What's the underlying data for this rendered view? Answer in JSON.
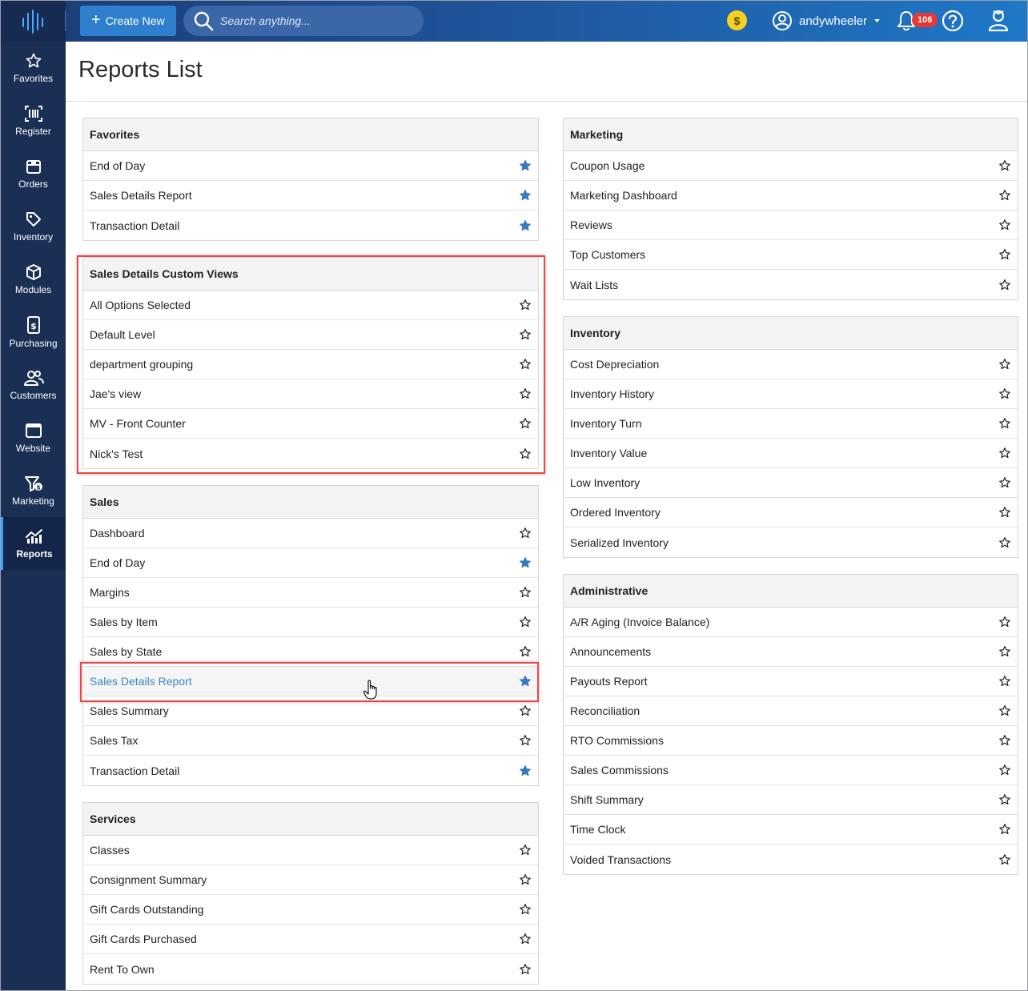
{
  "topbar": {
    "create_label": "Create New",
    "search_placeholder": "Search anything...",
    "coin_symbol": "$",
    "username": "andywheeler",
    "notification_count": "106"
  },
  "sidebar": {
    "items": [
      {
        "label": "Favorites",
        "icon": "star-icon"
      },
      {
        "label": "Register",
        "icon": "barcode-icon"
      },
      {
        "label": "Orders",
        "icon": "box-icon"
      },
      {
        "label": "Inventory",
        "icon": "tag-icon"
      },
      {
        "label": "Modules",
        "icon": "cube-icon"
      },
      {
        "label": "Purchasing",
        "icon": "invoice-icon"
      },
      {
        "label": "Customers",
        "icon": "users-icon"
      },
      {
        "label": "Website",
        "icon": "browser-icon"
      },
      {
        "label": "Marketing",
        "icon": "funnel-icon"
      },
      {
        "label": "Reports",
        "icon": "chart-icon",
        "active": true
      }
    ]
  },
  "page": {
    "title": "Reports List"
  },
  "sections": {
    "favorites": {
      "title": "Favorites",
      "items": [
        {
          "label": "End of Day",
          "starred": true
        },
        {
          "label": "Sales Details Report",
          "starred": true
        },
        {
          "label": "Transaction Detail",
          "starred": true
        }
      ]
    },
    "custom_views": {
      "title": "Sales Details Custom Views",
      "items": [
        {
          "label": "All Options Selected",
          "starred": false
        },
        {
          "label": "Default Level",
          "starred": false
        },
        {
          "label": "department grouping",
          "starred": false
        },
        {
          "label": "Jae's view",
          "starred": false
        },
        {
          "label": "MV - Front Counter",
          "starred": false
        },
        {
          "label": "Nick's Test",
          "starred": false
        }
      ]
    },
    "sales": {
      "title": "Sales",
      "items": [
        {
          "label": "Dashboard",
          "starred": false
        },
        {
          "label": "End of Day",
          "starred": true
        },
        {
          "label": "Margins",
          "starred": false
        },
        {
          "label": "Sales by Item",
          "starred": false
        },
        {
          "label": "Sales by State",
          "starred": false
        },
        {
          "label": "Sales Details Report",
          "starred": true,
          "hover": true
        },
        {
          "label": "Sales Summary",
          "starred": false
        },
        {
          "label": "Sales Tax",
          "starred": false
        },
        {
          "label": "Transaction Detail",
          "starred": true
        }
      ]
    },
    "services": {
      "title": "Services",
      "items": [
        {
          "label": "Classes",
          "starred": false
        },
        {
          "label": "Consignment Summary",
          "starred": false
        },
        {
          "label": "Gift Cards Outstanding",
          "starred": false
        },
        {
          "label": "Gift Cards Purchased",
          "starred": false
        },
        {
          "label": "Rent To Own",
          "starred": false
        }
      ]
    },
    "marketing": {
      "title": "Marketing",
      "items": [
        {
          "label": "Coupon Usage",
          "starred": false
        },
        {
          "label": "Marketing Dashboard",
          "starred": false
        },
        {
          "label": "Reviews",
          "starred": false
        },
        {
          "label": "Top Customers",
          "starred": false
        },
        {
          "label": "Wait Lists",
          "starred": false
        }
      ]
    },
    "inventory": {
      "title": "Inventory",
      "items": [
        {
          "label": "Cost Depreciation",
          "starred": false
        },
        {
          "label": "Inventory History",
          "starred": false
        },
        {
          "label": "Inventory Turn",
          "starred": false
        },
        {
          "label": "Inventory Value",
          "starred": false
        },
        {
          "label": "Low Inventory",
          "starred": false
        },
        {
          "label": "Ordered Inventory",
          "starred": false
        },
        {
          "label": "Serialized Inventory",
          "starred": false
        }
      ]
    },
    "administrative": {
      "title": "Administrative",
      "items": [
        {
          "label": "A/R Aging (Invoice Balance)",
          "starred": false
        },
        {
          "label": "Announcements",
          "starred": false
        },
        {
          "label": "Payouts Report",
          "starred": false
        },
        {
          "label": "Reconciliation",
          "starred": false
        },
        {
          "label": "RTO Commissions",
          "starred": false
        },
        {
          "label": "Sales Commissions",
          "starred": false
        },
        {
          "label": "Shift Summary",
          "starred": false
        },
        {
          "label": "Time Clock",
          "starred": false
        },
        {
          "label": "Voided Transactions",
          "starred": false
        }
      ]
    }
  },
  "colors": {
    "accent": "#2f7fcf",
    "star_filled": "#3a78c2",
    "highlight": "#e24a4a",
    "link": "#3d86c6"
  }
}
